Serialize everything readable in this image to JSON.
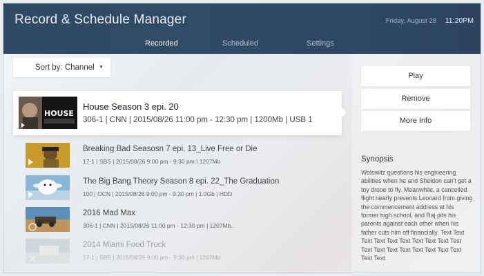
{
  "app": {
    "title": "Record & Schedule Manager",
    "date": "Friday, August 28",
    "time": "11:20PM"
  },
  "tabs": [
    {
      "label": "Recorded"
    },
    {
      "label": "Scheduled"
    },
    {
      "label": "Settings"
    }
  ],
  "sort": {
    "label": "Sort by: Channel",
    "caret_icon": "caret-down-icon"
  },
  "selected": {
    "title": "House Season 3 epi. 20",
    "meta": "306-1  |  CNN  |  2015/08/26  11:00 pm - 12:30 pm  |  1200Mb  |  USB 1",
    "thumb_text": "HOUSE"
  },
  "recordings": [
    {
      "title": "Breaking Bad Seasosn 7 epi. 13_Live Free or Die",
      "meta": "17-1  |  SBS  |  2015/08/26  9:00 pm - 9:30 pm   |   1207Mb"
    },
    {
      "title": "The Big Bang Theory Season 8 epi. 22_The Graduation",
      "meta": "100  |  OCN  |  2015/08/26  9:00 pm - 9:30 pm   |   1.0Gb   |   HDD"
    },
    {
      "title": "2016 Mad Max",
      "meta": "306-1  |  CNN  |  2015/08/26  11:00 pm - 12:30 pm   |   1207Mb.."
    },
    {
      "title": "2014 Miami Food Truck",
      "meta": "17-1  |  SBS  |  2015/08/26  9:00 pm - 9:30 pm   |   1207Mb"
    }
  ],
  "actions": {
    "play": "Play",
    "remove": "Remove",
    "more_info": "More Info"
  },
  "synopsis": {
    "title": "Synopsis",
    "text": "Wolowitz questions his engineering abilities when he and Sheldon can't get a toy drone to fly. Meanwhile, a cancelled flight nearly prevents Leonard from giving the commencement address at his former high school, and Raj pits his parents against each other when his father cuts him off financially. Text Text Text Text Text Text Text Text Text Text Text Text Text Text Text Text Text Text Text Text"
  },
  "colors": {
    "header": "#304b66",
    "accent": "#ffffff",
    "background": "#eceff2"
  }
}
